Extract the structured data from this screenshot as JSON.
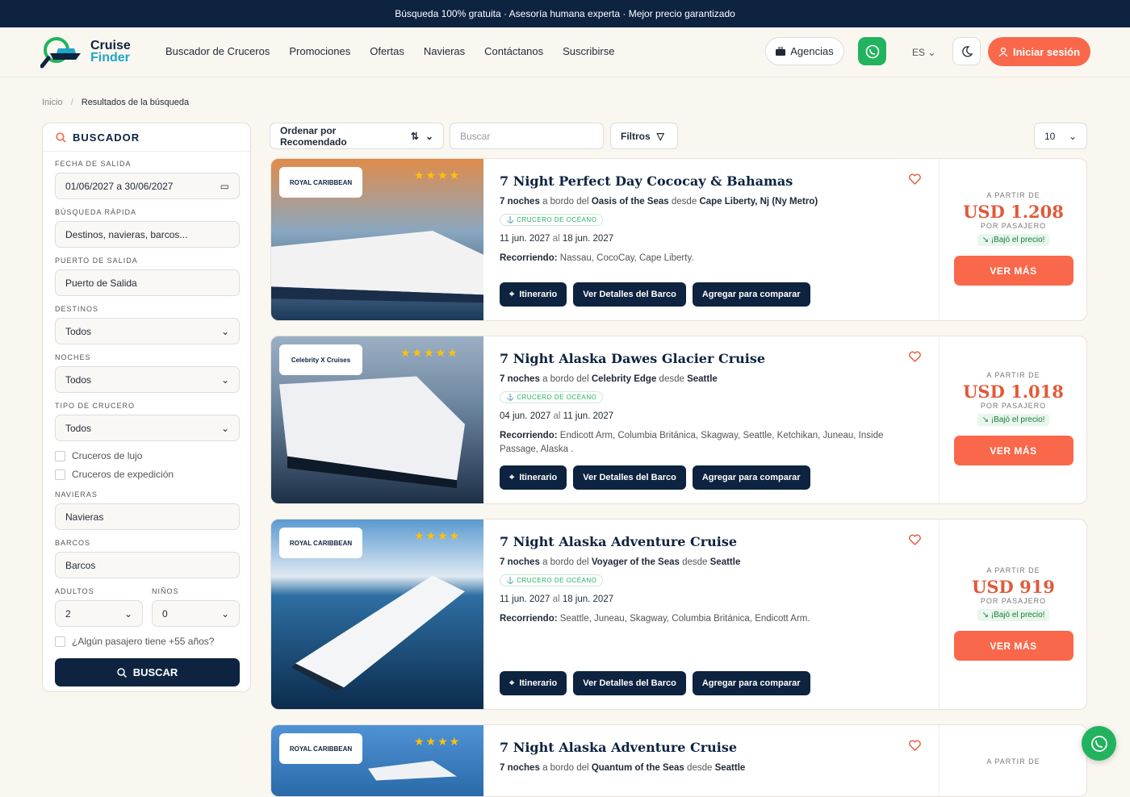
{
  "topbar": "Búsqueda 100% gratuita · Asesoría humana experta · Mejor precio garantizado",
  "logo": {
    "line1": "Cruise",
    "line2": "Finder"
  },
  "nav": [
    "Buscador de Cruceros",
    "Promociones",
    "Ofertas",
    "Navieras",
    "Contáctanos",
    "Suscribirse"
  ],
  "header": {
    "agencias": "Agencias",
    "lang": "ES",
    "login": "Iniciar sesión"
  },
  "breadcrumb": {
    "home": "Inicio",
    "sep": "/",
    "current": "Resultados de la búsqueda"
  },
  "sidebar": {
    "title": "BUSCADOR",
    "fecha_label": "FECHA DE SALIDA",
    "fecha_value": "01/06/2027 a 30/06/2027",
    "rapida_label": "BÚSQUEDA RÁPIDA",
    "rapida_placeholder": "Destinos, navieras, barcos...",
    "puerto_label": "PUERTO DE SALIDA",
    "puerto_placeholder": "Puerto de Salida",
    "destinos_label": "DESTINOS",
    "destinos_value": "Todos",
    "noches_label": "NOCHES",
    "noches_value": "Todos",
    "tipo_label": "TIPO DE CRUCERO",
    "tipo_value": "Todos",
    "lujo": "Cruceros de lujo",
    "expedicion": "Cruceros de expedición",
    "navieras_label": "NAVIERAS",
    "navieras_placeholder": "Navieras",
    "barcos_label": "BARCOS",
    "barcos_placeholder": "Barcos",
    "adultos_label": "ADULTOS",
    "adultos_value": "2",
    "ninos_label": "NIÑOS",
    "ninos_value": "0",
    "mayor55": "¿Algún pasajero tiene +55 años?",
    "buscar": "BUSCAR"
  },
  "toolbar": {
    "sort": "Ordenar por Recomendado",
    "search_placeholder": "Buscar",
    "filters": "Filtros",
    "per_page": "10"
  },
  "labels": {
    "a_partir": "A PARTIR DE",
    "por_pasajero": "POR PASAJERO",
    "bajo": "¡Bajó el precio!",
    "ver_mas": "VER MÁS",
    "itinerario": "Itinerario",
    "detalles": "Ver Detalles del Barco",
    "comparar": "Agregar para comparar",
    "tipo": "CRUCERO DE OCÉANO",
    "a_bordo": "a bordo del",
    "desde": "desde",
    "al": "al",
    "recorriendo": "Recorriendo:"
  },
  "cruises": [
    {
      "title": "7 Night Perfect Day Cococay & Bahamas",
      "noches": "7 noches",
      "ship": "Oasis of the Seas",
      "port": "Cape Liberty, Nj (Ny Metro)",
      "start": "11 jun. 2027",
      "end": "18 jun. 2027",
      "route": "Nassau, CocoCay, Cape Liberty.",
      "price": "USD 1.208",
      "brand": "ROYAL CARIBBEAN",
      "stars": 4
    },
    {
      "title": "7 Night Alaska Dawes Glacier Cruise",
      "noches": "7 noches",
      "ship": "Celebrity Edge",
      "port": "Seattle",
      "start": "04 jun. 2027",
      "end": "11 jun. 2027",
      "route": "Endicott Arm, Columbia Británica, Skagway, Seattle, Ketchikan, Juneau, Inside Passage, Alaska .",
      "price": "USD 1.018",
      "brand": "Celebrity X Cruises",
      "stars": 5
    },
    {
      "title": "7 Night Alaska Adventure Cruise",
      "noches": "7 noches",
      "ship": "Voyager of the Seas",
      "port": "Seattle",
      "start": "11 jun. 2027",
      "end": "18 jun. 2027",
      "route": "Seattle, Juneau, Skagway, Columbia Británica, Endicott Arm.",
      "price": "USD 919",
      "brand": "ROYAL CARIBBEAN",
      "stars": 4
    },
    {
      "title": "7 Night Alaska Adventure Cruise",
      "noches": "7 noches",
      "ship": "Quantum of the Seas",
      "port": "Seattle",
      "brand": "ROYAL CARIBBEAN",
      "stars": 4
    }
  ]
}
